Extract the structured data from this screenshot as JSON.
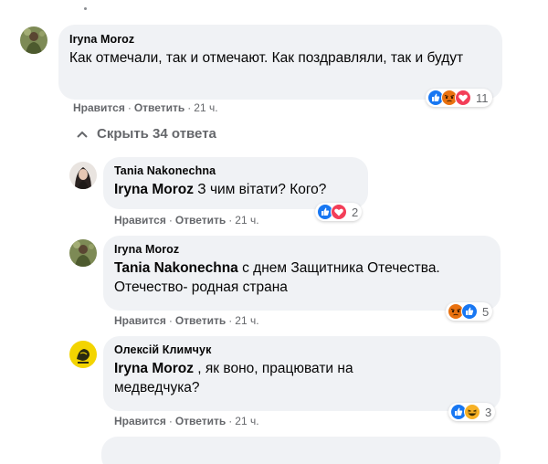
{
  "comment": {
    "author": "Iryna Moroz",
    "text": "Как отмечали, так и отмечают. Как поздравляли, так и будут",
    "actions": {
      "like": "Нравится",
      "reply": "Ответить",
      "time": "21 ч."
    },
    "reaction_count": "11",
    "reaction_icons": [
      "like-icon",
      "angry-icon",
      "love-icon"
    ]
  },
  "hide_replies_label": "Скрыть 34 ответа",
  "replies": [
    {
      "author": "Tania Nakonechna",
      "mention": "Iryna Moroz",
      "text": " З чим вітати? Кого?",
      "actions": {
        "like": "Нравится",
        "reply": "Ответить",
        "time": "21 ч."
      },
      "reaction_count": "2",
      "reaction_icons": [
        "like-icon",
        "love-icon"
      ]
    },
    {
      "author": "Iryna Moroz",
      "mention": "Tania Nakonechna",
      "text": " с днем Защитника Отечества. Отечество- родная страна",
      "actions": {
        "like": "Нравится",
        "reply": "Ответить",
        "time": "21 ч."
      },
      "reaction_count": "5",
      "reaction_icons": [
        "angry-icon",
        "like-icon"
      ]
    },
    {
      "author": "Олексій Климчук",
      "mention": "Iryna Moroz",
      "text": " , як воно, працювати на медведчука?",
      "actions": {
        "like": "Нравится",
        "reply": "Ответить",
        "time": "21 ч."
      },
      "reaction_count": "3",
      "reaction_icons": [
        "like-icon",
        "haha-icon"
      ]
    }
  ],
  "colors": {
    "bubble": "#f0f2f5",
    "secondary_text": "#65676b",
    "like_blue": "#1877f2",
    "love_red": "#f33e58",
    "angry_orange": "#e9710f",
    "haha_yellow": "#f7b125"
  }
}
